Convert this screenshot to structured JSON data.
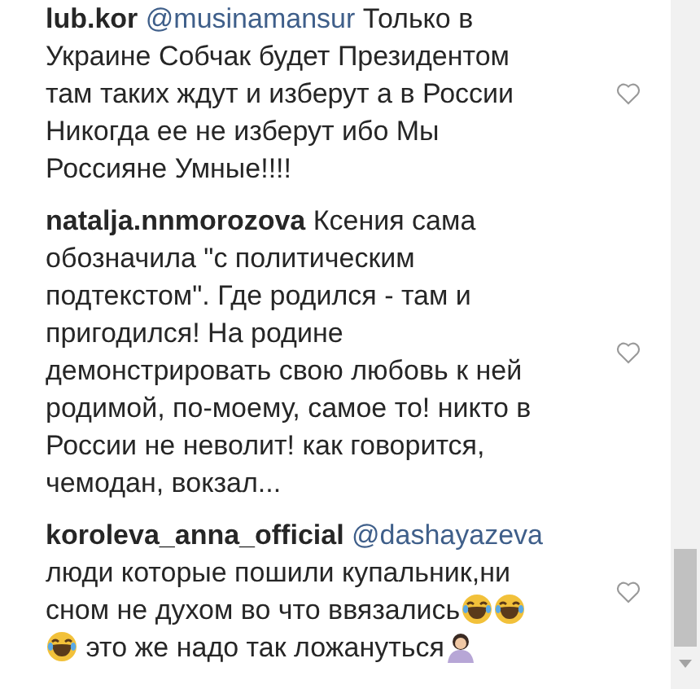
{
  "comments": [
    {
      "username": "lub.kor",
      "mention": "@musinamansur",
      "parts": [
        {
          "kind": "text",
          "text": "Только в Украине Собчак будет Президентом там таких ждут и изберут а в России Никогда ее не изберут ибо Мы Россияне Умные!!!!"
        }
      ],
      "liked": false
    },
    {
      "username": "natalja.nnmorozova",
      "parts": [
        {
          "kind": "text",
          "text": "Ксения сама обозначила \"с политическим подтекстом\". Где родился - там и пригодился! На родине демонстрировать свою любовь к ней родимой, по-моему, самое то! никто в России не неволит! как говорится, чемодан, вокзал..."
        }
      ],
      "liked": false
    },
    {
      "username": "koroleva_anna_official",
      "mention": "@dashayazeva",
      "parts": [
        {
          "kind": "text",
          "text": "люди которые пошили купальник,ни сном не духом во что ввязались"
        },
        {
          "kind": "laugh"
        },
        {
          "kind": "laugh"
        },
        {
          "kind": "laugh"
        },
        {
          "kind": "text",
          "text": " это же надо так ложануться"
        },
        {
          "kind": "person"
        }
      ],
      "liked": false
    }
  ]
}
